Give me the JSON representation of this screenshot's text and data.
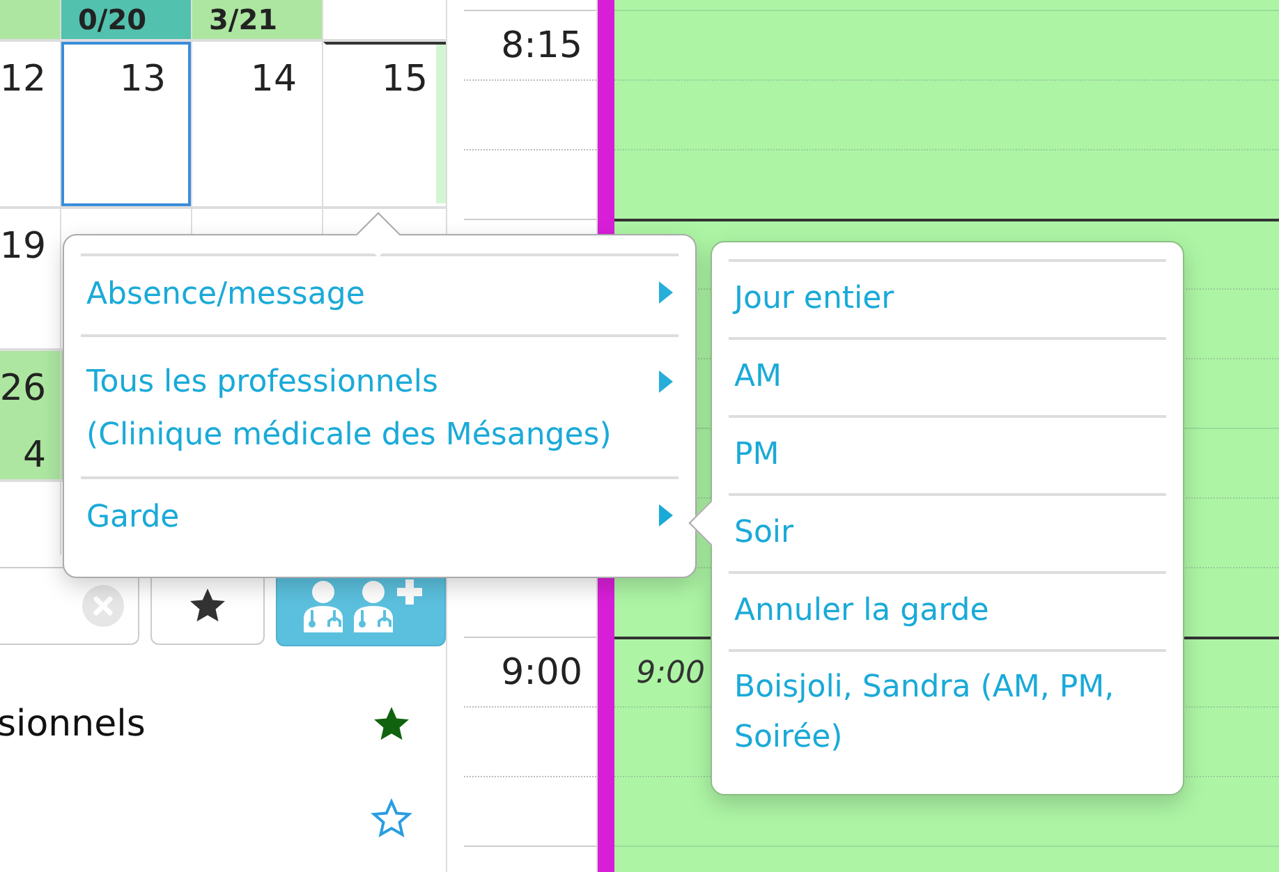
{
  "calendar": {
    "header": [
      {
        "color": "#ace6a0"
      },
      {
        "text": "0/20",
        "color": "#52c1ae"
      },
      {
        "text": "3/21",
        "color": "#ace6a0"
      },
      {
        "color": "#ffffff"
      }
    ],
    "weeks": [
      {
        "shaded": false,
        "days": [
          {
            "label": "12",
            "selected": false,
            "current": false
          },
          {
            "label": "13",
            "selected": true,
            "current": false
          },
          {
            "label": "14",
            "selected": false,
            "current": false
          },
          {
            "label": "15",
            "selected": false,
            "current": true
          }
        ]
      },
      {
        "shaded": false,
        "days": [
          {
            "label": "19",
            "selected": false,
            "current": false
          }
        ]
      },
      {
        "shaded": true,
        "days": [
          {
            "label": "26",
            "note": "4",
            "selected": false,
            "current": false
          }
        ]
      }
    ]
  },
  "toolbar": {
    "favorites_on": false,
    "add_professional_on": true
  },
  "professionals": [
    {
      "name": "sionnels",
      "favorite": true
    },
    {
      "favorite": false
    }
  ],
  "time_labels": [
    "8:15",
    "9:00"
  ],
  "day_column": {
    "labels": [
      "9:00"
    ]
  },
  "context_menu": {
    "items": [
      {
        "label": "Absence/message",
        "submenu": true,
        "expanded": false
      },
      {
        "label": "Tous les professionnels\n(Clinique médicale des Mésanges)",
        "submenu": true,
        "expanded": false
      },
      {
        "label": "Garde",
        "submenu": true,
        "expanded": true
      }
    ]
  },
  "submenu": {
    "items": [
      "Jour entier",
      "AM",
      "PM",
      "Soir",
      "Annuler la garde",
      "Boisjoli, Sandra (AM, PM, Soirée)"
    ]
  }
}
